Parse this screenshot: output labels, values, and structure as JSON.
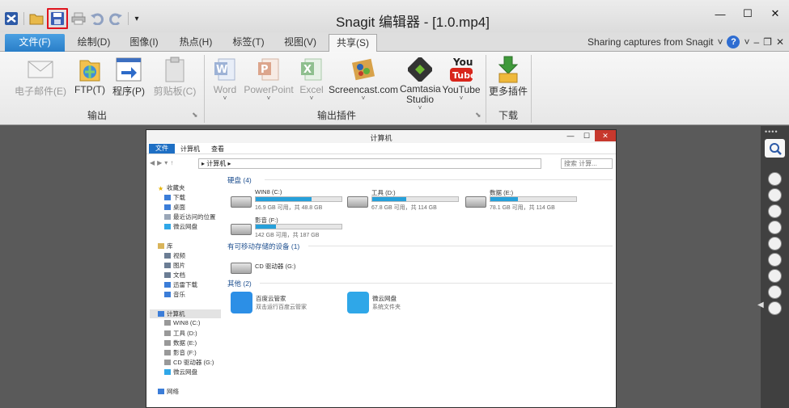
{
  "window": {
    "title": "Snagit 编辑器 - [1.0.mp4]",
    "minimize_glyph": "—",
    "maximize_glyph": "☐",
    "close_glyph": "✕"
  },
  "quick_access": {
    "icons": [
      "snagit-logo-icon",
      "open-folder-icon",
      "save-icon",
      "print-icon",
      "undo-icon",
      "redo-icon",
      "customize-icon"
    ],
    "customize_glyph": "▾"
  },
  "tabs": [
    {
      "label": "文件(F)",
      "active": false,
      "type": "file"
    },
    {
      "label": "绘制(D)",
      "active": false
    },
    {
      "label": "图像(I)",
      "active": false
    },
    {
      "label": "热点(H)",
      "active": false
    },
    {
      "label": "标签(T)",
      "active": false
    },
    {
      "label": "视图(V)",
      "active": false
    },
    {
      "label": "共享(S)",
      "active": true
    }
  ],
  "tab_right": {
    "sharing_text": "Sharing captures from Snagit",
    "dropdown_glyph": "˅",
    "help_glyph": "?",
    "extra_glyphs": [
      "˅",
      "–",
      "❐",
      "✕"
    ]
  },
  "ribbon": {
    "output_group": {
      "label": "输出",
      "buttons": [
        {
          "label": "电子邮件(E)",
          "icon": "email-icon",
          "enabled": false
        },
        {
          "label": "FTP(T)",
          "icon": "ftp-icon",
          "enabled": true
        },
        {
          "label": "程序(P)",
          "icon": "program-icon",
          "enabled": true
        },
        {
          "label": "剪贴板(C)",
          "icon": "clipboard-icon",
          "enabled": false
        }
      ]
    },
    "plugins_group": {
      "label": "输出插件",
      "buttons": [
        {
          "label": "Word",
          "icon": "word-icon",
          "enabled": false,
          "caret": "˅"
        },
        {
          "label": "PowerPoint",
          "icon": "powerpoint-icon",
          "enabled": false,
          "caret": "˅"
        },
        {
          "label": "Excel",
          "icon": "excel-icon",
          "enabled": false,
          "caret": "˅"
        },
        {
          "label": "Screencast.com",
          "icon": "screencast-icon",
          "enabled": true,
          "caret": "˅"
        },
        {
          "label": "Camtasia Studio",
          "icon": "camtasia-icon",
          "enabled": true,
          "caret": "˅"
        },
        {
          "label": "YouTube",
          "icon": "youtube-icon",
          "enabled": true,
          "caret": "˅"
        }
      ]
    },
    "download_group": {
      "label": "下载",
      "buttons": [
        {
          "label": "更多插件",
          "icon": "more-plugins-icon",
          "enabled": true
        }
      ]
    }
  },
  "capture": {
    "title": "计算机",
    "tabs": [
      "文件",
      "计算机",
      "查看"
    ],
    "address": "▸ 计算机 ▸",
    "search_placeholder": "搜索 计算...",
    "nav": {
      "favorites": [
        "收藏夹",
        "下载",
        "桌面",
        "最近访问的位置",
        "微云网盘"
      ],
      "libraries": [
        "库",
        "视频",
        "图片",
        "文档",
        "迅雷下载",
        "音乐"
      ],
      "computer": [
        "计算机",
        "WIN8 (C:)",
        "工具 (D:)",
        "数据 (E:)",
        "影音 (F:)",
        "CD 驱动器 (G:)",
        "微云网盘"
      ],
      "network": "网络"
    },
    "sections": {
      "disks": "硬盘 (4)",
      "removable": "有可移动存储的设备 (1)",
      "other": "其他 (2)"
    },
    "drives": [
      {
        "name": "WIN8 (C:)",
        "size": "16.9 GB 可用，共 48.8 GB",
        "used_fraction": 0.65
      },
      {
        "name": "工具 (D:)",
        "size": "67.8 GB 可用，共 114 GB",
        "used_fraction": 0.4
      },
      {
        "name": "数据 (E:)",
        "size": "78.1 GB 可用，共 114 GB",
        "used_fraction": 0.32
      },
      {
        "name": "影音 (F:)",
        "size": "142 GB 可用，共 187 GB",
        "used_fraction": 0.24
      }
    ],
    "cd_drive": "CD 驱动器 (G:)",
    "apps": [
      {
        "name": "百度云管家",
        "desc": "双击运行百度云管家",
        "color": "#2c8fe6"
      },
      {
        "name": "微云网盘",
        "desc": "系统文件夹",
        "color": "#2fa7e8"
      }
    ]
  },
  "tool_strip": {
    "tools": [
      "search-icon",
      "stamp-icon",
      "radiation-icon",
      "flag-icon",
      "smiley-icon",
      "heart-icon",
      "dollar-icon",
      "clock-icon",
      "check-icon",
      "star-icon"
    ]
  }
}
